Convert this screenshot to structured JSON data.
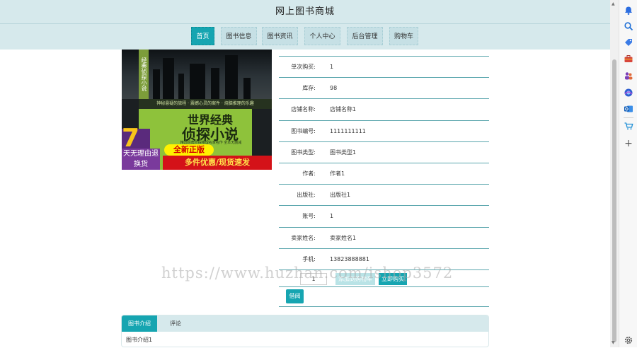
{
  "header": {
    "title": "网上图书商城"
  },
  "nav": {
    "items": [
      {
        "label": "首页",
        "active": true
      },
      {
        "label": "图书信息"
      },
      {
        "label": "图书资讯"
      },
      {
        "label": "个人中心"
      },
      {
        "label": "后台管理"
      },
      {
        "label": "购物车"
      }
    ]
  },
  "cover": {
    "spine_text": "经典侦探小说",
    "tagline": "神秘悬疑的旅程 · 震撼心灵的案件 · 烧脑推理的乐趣",
    "title_line1": "世界经典",
    "title_line2": "侦探小说",
    "subtitle": "精选经典侦探推理名家名作 全本无删减",
    "badge_number": "7",
    "badge_text": "天无理由退换货",
    "promo_yellow": "全新正版",
    "promo_red": "多件优惠/现货速发"
  },
  "details": {
    "rows": [
      {
        "label": "单次购买:",
        "value": "1"
      },
      {
        "label": "库存:",
        "value": "98"
      },
      {
        "label": "店铺名称:",
        "value": "店铺名称1"
      },
      {
        "label": "图书编号:",
        "value": "1111111111"
      },
      {
        "label": "图书类型:",
        "value": "图书类型1"
      },
      {
        "label": "作者:",
        "value": "作者1"
      },
      {
        "label": "出版社:",
        "value": "出版社1"
      },
      {
        "label": "账号:",
        "value": "1"
      },
      {
        "label": "卖家姓名:",
        "value": "卖家姓名1"
      },
      {
        "label": "手机:",
        "value": "13823888881"
      }
    ],
    "quantity": "1",
    "add_cart_label": "添加到购物车",
    "buy_now_label": "立即购买",
    "borrow_label": "借阅"
  },
  "tabs": {
    "items": [
      {
        "label": "图书介绍",
        "active": true
      },
      {
        "label": "评论"
      }
    ],
    "content": "图书介绍1"
  },
  "watermark": "https://www.huzhan.com/ishop3572",
  "siderail": {
    "icons": [
      "bell-icon",
      "search-icon",
      "tag-icon",
      "toolbox-icon",
      "people-icon",
      "orb-icon",
      "outlook-icon",
      "cart-icon",
      "plus-icon",
      "settings-icon"
    ]
  },
  "colors": {
    "accent": "#16a5b1",
    "header_bg": "#d6e9ec",
    "row_border": "#5aa6ad"
  }
}
